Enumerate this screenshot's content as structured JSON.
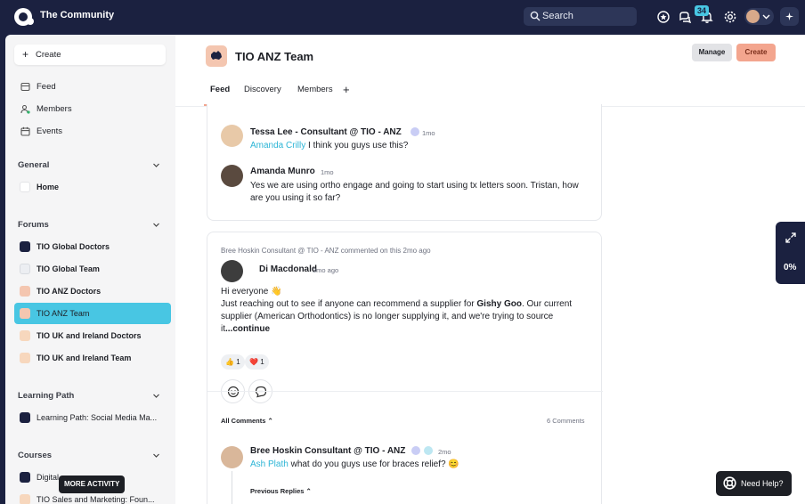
{
  "header": {
    "app_title": "The Community",
    "search_placeholder": "Search",
    "notification_count": "34"
  },
  "sidebar": {
    "create_label": "Create",
    "nav": [
      {
        "label": "Feed"
      },
      {
        "label": "Members"
      },
      {
        "label": "Events"
      }
    ],
    "general": {
      "title": "General",
      "items": [
        {
          "label": "Home"
        }
      ]
    },
    "forums": {
      "title": "Forums",
      "items": [
        {
          "label": "TIO Global Doctors"
        },
        {
          "label": "TIO Global Team"
        },
        {
          "label": "TIO ANZ Doctors"
        },
        {
          "label": "TIO ANZ Team",
          "active": true
        },
        {
          "label": "TIO UK and Ireland Doctors"
        },
        {
          "label": "TIO UK and Ireland Team"
        }
      ]
    },
    "learning_path": {
      "title": "Learning Path",
      "items": [
        {
          "label": "Learning Path: Social Media Ma..."
        }
      ]
    },
    "courses": {
      "title": "Courses",
      "items": [
        {
          "label": "Digital"
        },
        {
          "label": "TIO Sales and Marketing: Foun..."
        }
      ]
    },
    "more_activity_label": "MORE ACTIVITY"
  },
  "main": {
    "team_title": "TIO ANZ Team",
    "manage_label": "Manage",
    "create_label": "Create",
    "tabs": [
      {
        "label": "Feed",
        "active": true
      },
      {
        "label": "Discovery"
      },
      {
        "label": "Members"
      }
    ],
    "tab_add": "+",
    "thread1": {
      "comment1": {
        "author": "Tessa Lee - Consultant @ TIO - ANZ",
        "time": "1mo",
        "mention": "Amanda Crilly",
        "text": " I think you guys use this?"
      },
      "comment2": {
        "author": "Amanda Munro",
        "time": "1mo",
        "text": "Yes we are using ortho engage and going to start using tx letters soon. Tristan, how are you using it so far?"
      }
    },
    "post": {
      "activity": "Bree Hoskin Consultant @ TIO - ANZ commented on this 2mo ago",
      "author": "Di Macdonald",
      "time": "3mo ago",
      "greeting": "Hi everyone 👋",
      "body_start": "Just reaching out to see if anyone can recommend a supplier for ",
      "body_bold": "Gishy Goo",
      "body_end": ". Our current supplier (American Orthodontics) is no longer supplying it, and we're trying to source it",
      "continue_label": "...continue",
      "reactions": [
        {
          "emoji": "👍",
          "count": "1"
        },
        {
          "emoji": "❤️",
          "count": "1"
        }
      ],
      "all_comments_label": "All Comments",
      "comments_count": "6 Comments",
      "reply": {
        "author": "Bree Hoskin Consultant @ TIO - ANZ",
        "time": "2mo",
        "mention": "Ash Plath",
        "text": " what do you guys use for braces relief? 😊"
      },
      "previous_replies_label": "Previous Replies"
    }
  },
  "progress_widget": {
    "percent": "0%"
  },
  "help": {
    "label": "Need Help?"
  },
  "colors": {
    "navy": "#1b2140",
    "accent_cyan": "#48c6e3",
    "accent_salmon": "#f3a58e"
  }
}
